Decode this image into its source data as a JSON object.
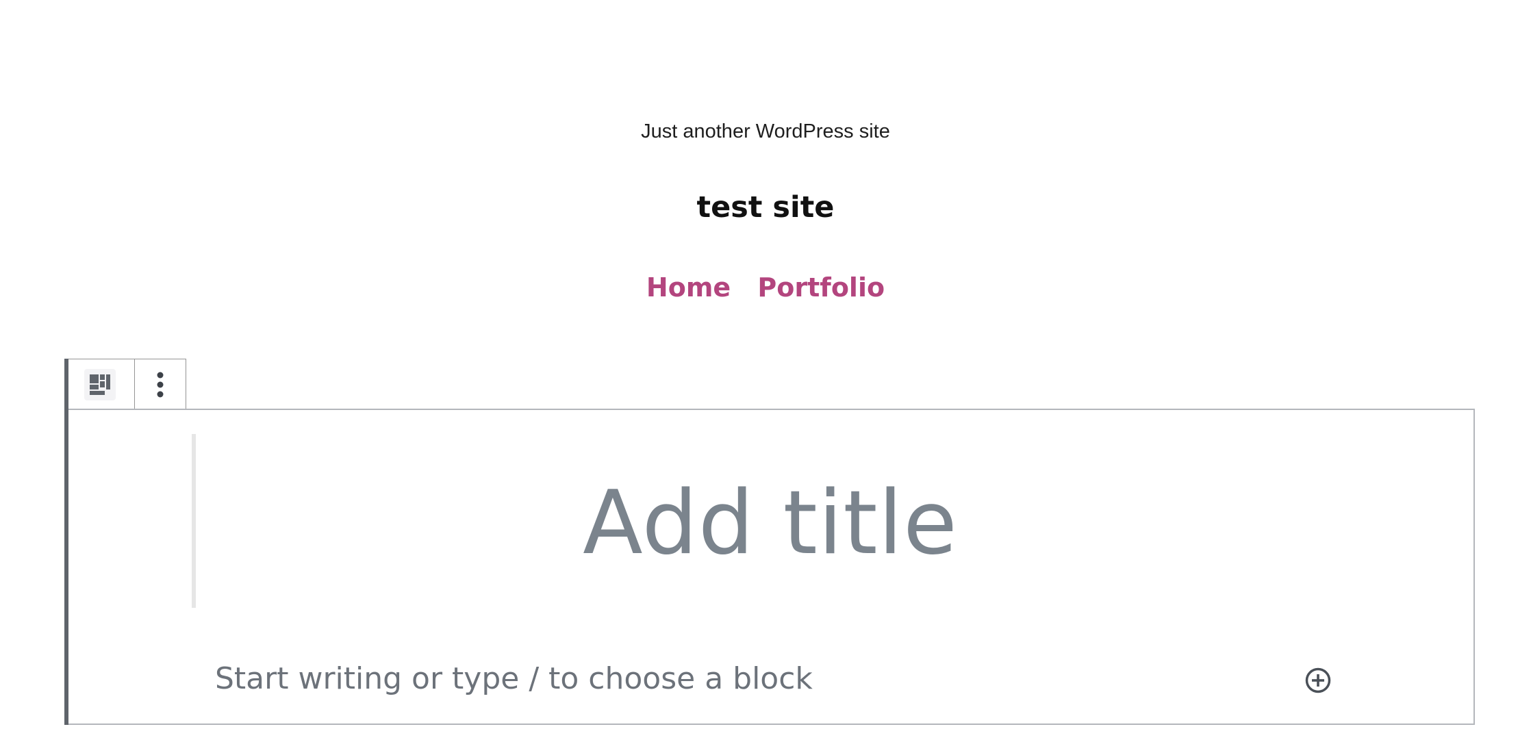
{
  "site": {
    "tagline": "Just another WordPress site",
    "title": "test site",
    "nav": [
      {
        "label": "Home"
      },
      {
        "label": "Portfolio"
      }
    ],
    "link_color": "#b3457e"
  },
  "toolbar": {
    "block_type_icon": "template-part-icon",
    "options_icon": "more-vertical-icon"
  },
  "editor": {
    "title_placeholder": "Add title",
    "body_placeholder": "Start writing or type / to choose a block",
    "inserter_icon": "add-block-icon",
    "accent_border": "#5f646b",
    "placeholder_color": "#7b848d"
  }
}
